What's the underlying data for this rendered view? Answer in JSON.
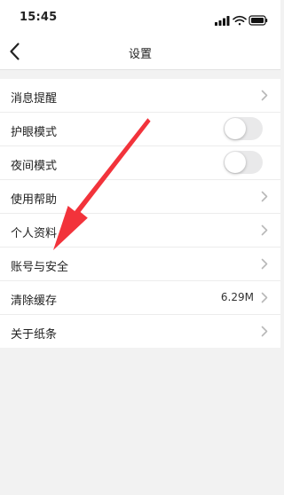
{
  "status_bar": {
    "time": "15:45"
  },
  "nav": {
    "title": "设置"
  },
  "settings": [
    {
      "label": "消息提醒",
      "control": "chevron"
    },
    {
      "label": "护眼模式",
      "control": "toggle",
      "on": false
    },
    {
      "label": "夜间模式",
      "control": "toggle",
      "on": false
    },
    {
      "label": "使用帮助",
      "control": "chevron"
    },
    {
      "label": "个人资料",
      "control": "chevron"
    },
    {
      "label": "账号与安全",
      "control": "chevron"
    },
    {
      "label": "清除缓存",
      "control": "chevron",
      "value": "6.29M"
    },
    {
      "label": "关于纸条",
      "control": "chevron"
    }
  ],
  "colors": {
    "annotation_arrow": "#f2333b",
    "toggle_off": "#e9e9ea"
  },
  "icons": [
    "signal-icon",
    "wifi-icon",
    "battery-icon",
    "back-chevron-icon",
    "chevron-right-icon",
    "annotation-arrow"
  ]
}
